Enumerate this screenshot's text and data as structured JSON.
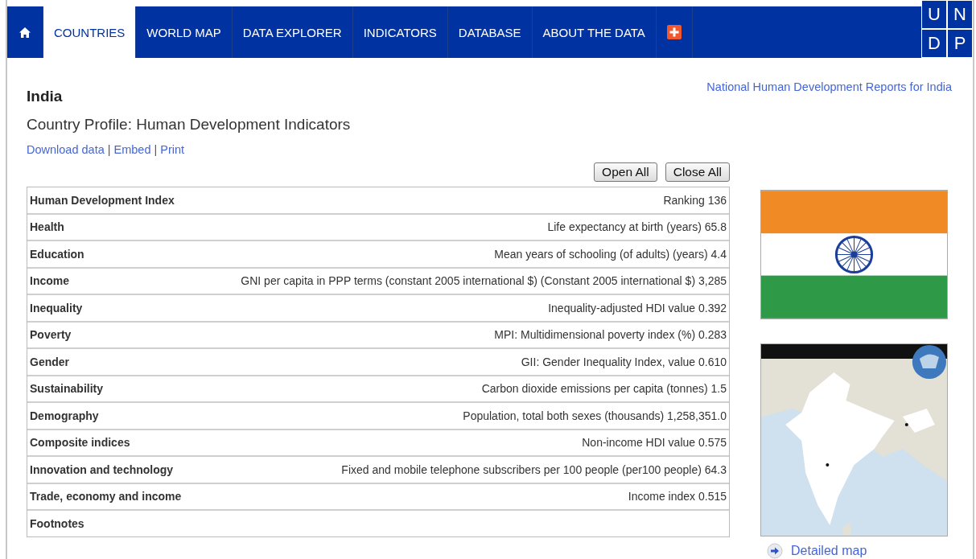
{
  "nav": {
    "items": [
      {
        "kind": "home",
        "selected": false
      },
      {
        "kind": "text",
        "label": "COUNTRIES",
        "selected": true
      },
      {
        "kind": "text",
        "label": "WORLD MAP",
        "selected": false
      },
      {
        "kind": "text",
        "label": "DATA EXPLORER",
        "selected": false
      },
      {
        "kind": "text",
        "label": "INDICATORS",
        "selected": false
      },
      {
        "kind": "text",
        "label": "DATABASE",
        "selected": false
      },
      {
        "kind": "text",
        "label": "ABOUT THE DATA",
        "selected": false
      },
      {
        "kind": "plus",
        "selected": false
      }
    ],
    "logo": [
      "U",
      "N",
      "D",
      "P"
    ]
  },
  "header": {
    "country": "India",
    "subtitle": "Country Profile: Human Development Indicators",
    "report_link": "National Human Development Reports for India",
    "links": [
      {
        "kind": "link",
        "text": "Download data"
      },
      {
        "kind": "separator",
        "text": "|"
      },
      {
        "kind": "link",
        "text": "Embed"
      },
      {
        "kind": "separator",
        "text": "|"
      },
      {
        "kind": "link",
        "text": "Print"
      }
    ]
  },
  "buttons": [
    "Open All",
    "Close All"
  ],
  "table": {
    "rows": [
      {
        "label": "Human Development Index",
        "indicator": "Ranking",
        "value": "136"
      },
      {
        "label": "Health",
        "indicator": "Life expectancy at birth (years)",
        "value": "65.8"
      },
      {
        "label": "Education",
        "indicator": "Mean years of schooling (of adults) (years)",
        "value": "4.4"
      },
      {
        "label": "Income",
        "indicator": "GNI per capita in PPP terms (constant 2005 international $) (Constant 2005 international $)",
        "value": "3,285"
      },
      {
        "label": "Inequality",
        "indicator": "Inequality-adjusted HDI value",
        "value": "0.392"
      },
      {
        "label": "Poverty",
        "indicator": "MPI: Multidimensional poverty index (%)",
        "value": "0.283"
      },
      {
        "label": "Gender",
        "indicator": "GII: Gender Inequality Index, value",
        "value": "0.610"
      },
      {
        "label": "Sustainability",
        "indicator": "Carbon dioxide emissions per capita (tonnes)",
        "value": "1.5"
      },
      {
        "label": "Demography",
        "indicator": "Population, total both sexes (thousands)",
        "value": "1,258,351.0"
      },
      {
        "label": "Composite indices",
        "indicator": "Non-income HDI value",
        "value": "0.575"
      },
      {
        "label": "Innovation and technology",
        "indicator": "Fixed and mobile telephone subscribers per 100 people (per100 people)",
        "value": "64.3"
      },
      {
        "label": "Trade, economy and income",
        "indicator": "Income index",
        "value": "0.515"
      },
      {
        "label": "Footnotes"
      }
    ]
  },
  "sidebar": {
    "map_link": "Detailed map"
  }
}
